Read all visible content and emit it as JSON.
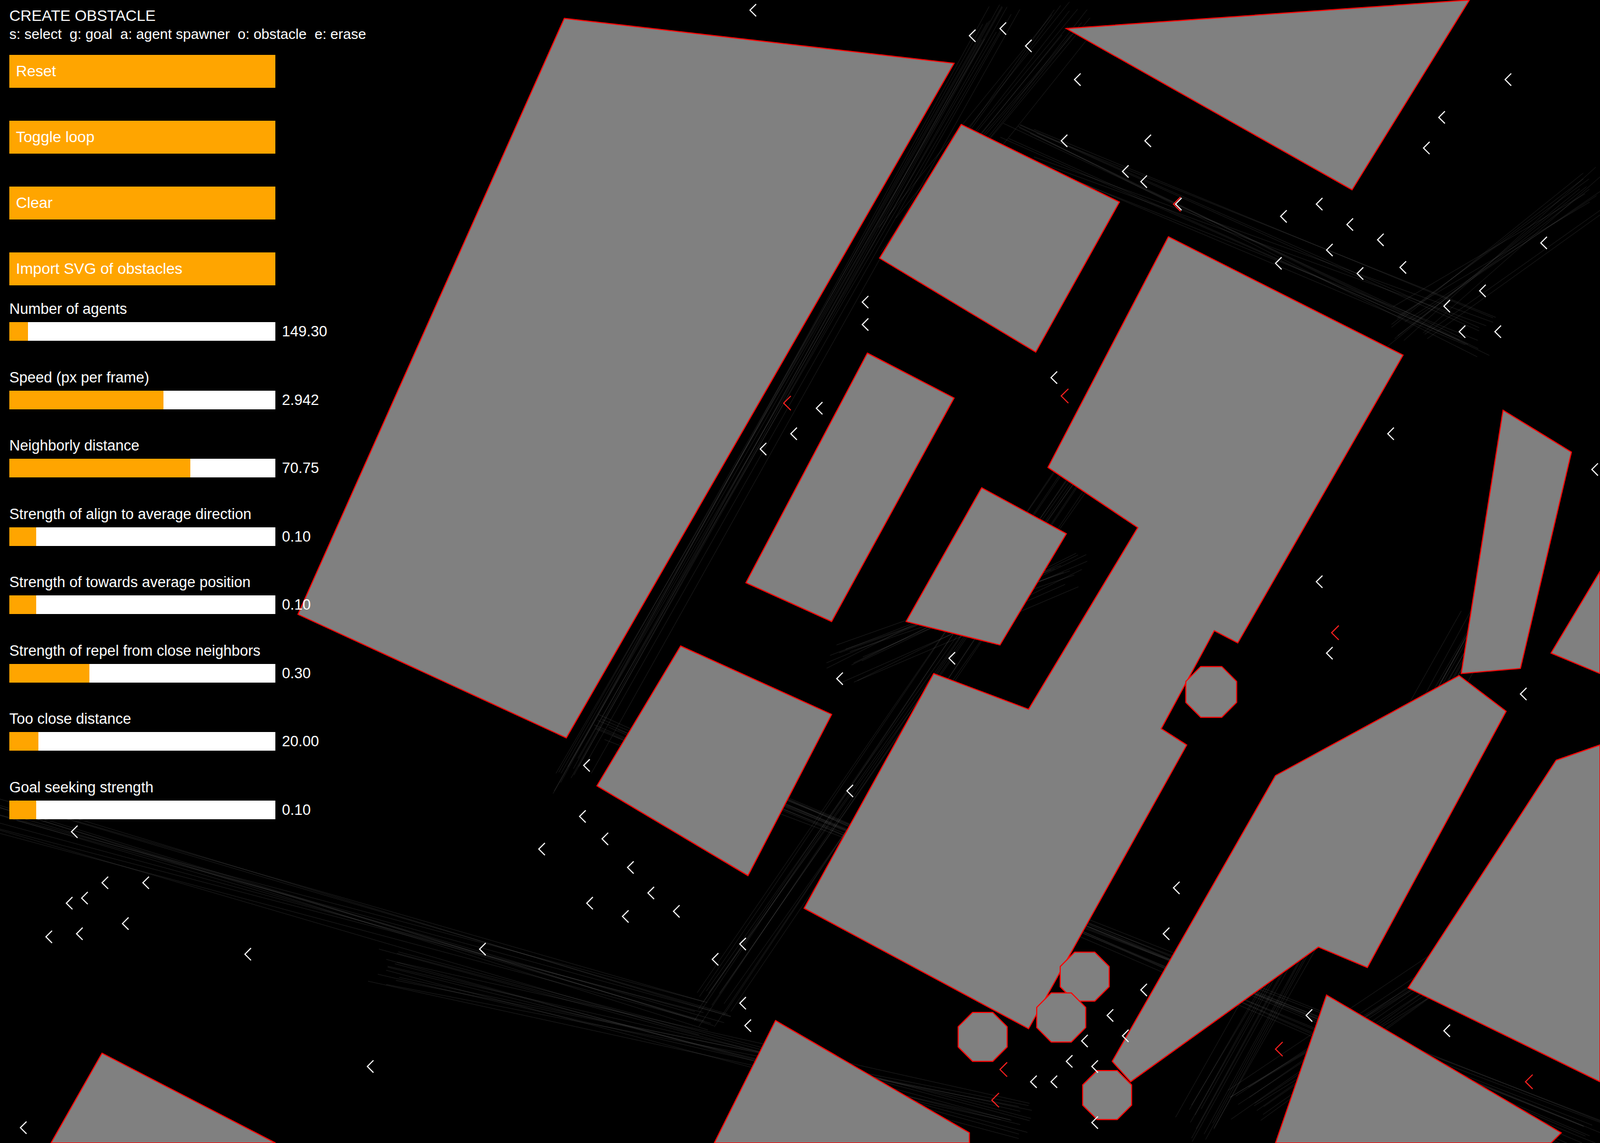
{
  "mode": {
    "title": "CREATE OBSTACLE",
    "hint": "s: select  g: goal  a: agent spawner  o: obstacle  e: erase"
  },
  "buttons": [
    "Reset",
    "Toggle loop",
    "Clear",
    "Import SVG of obstacles"
  ],
  "sliders": [
    {
      "label": "Number of agents",
      "level": 0.07,
      "reading": "149.30"
    },
    {
      "label": "Speed (px per frame)",
      "level": 0.58,
      "reading": "2.942"
    },
    {
      "label": "Neighborly distance",
      "level": 0.68,
      "reading": "70.75"
    },
    {
      "label": "Strength of align to average direction",
      "level": 0.1,
      "reading": "0.10"
    },
    {
      "label": "Strength of towards average position",
      "level": 0.1,
      "reading": "0.10"
    },
    {
      "label": "Strength of repel from close neighbors",
      "level": 0.3,
      "reading": "0.30"
    },
    {
      "label": "Too close distance",
      "level": 0.11,
      "reading": "20.00"
    },
    {
      "label": "Goal seeking strength",
      "level": 0.1,
      "reading": "0.10"
    }
  ]
}
